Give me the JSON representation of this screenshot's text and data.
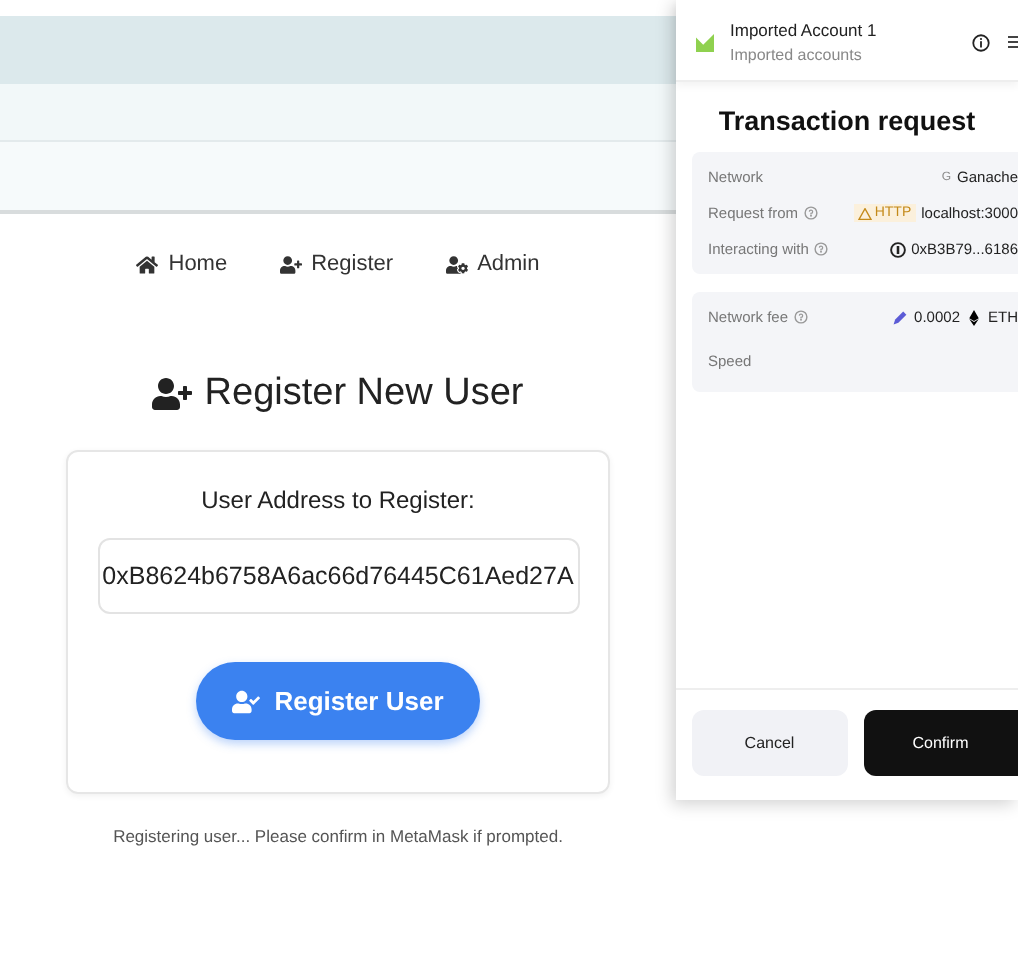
{
  "nav": [
    {
      "kind": "home",
      "label": "Home"
    },
    {
      "kind": "register",
      "label": "Register"
    },
    {
      "kind": "admin",
      "label": "Admin"
    }
  ],
  "heading": "Register New User",
  "form": {
    "label": "User Address to Register:",
    "value": "0xB8624b6758A6ac66d76445C61Aed27A",
    "button": "Register User"
  },
  "status": "Registering user... Please confirm in MetaMask if prompted.",
  "wallet": {
    "account": "Imported Account 1",
    "account_group": "Imported accounts",
    "title": "Transaction request",
    "details": [
      {
        "label": "Network",
        "value": "Ganache",
        "kind": "network",
        "badge": "G"
      },
      {
        "label": "Request from",
        "value": "localhost:3000",
        "kind": "origin",
        "badge": "HTTP"
      },
      {
        "label": "Interacting with",
        "value": "0xB3B79...6186",
        "kind": "contract"
      }
    ],
    "fees": [
      {
        "label": "Network fee",
        "value": "0.0002",
        "unit": "ETH",
        "kind": "fee"
      },
      {
        "label": "Speed",
        "kind": "plain"
      }
    ],
    "buttons": [
      {
        "label": "Cancel",
        "kind": "secondary"
      },
      {
        "label": "Confirm",
        "kind": "primary"
      }
    ]
  }
}
